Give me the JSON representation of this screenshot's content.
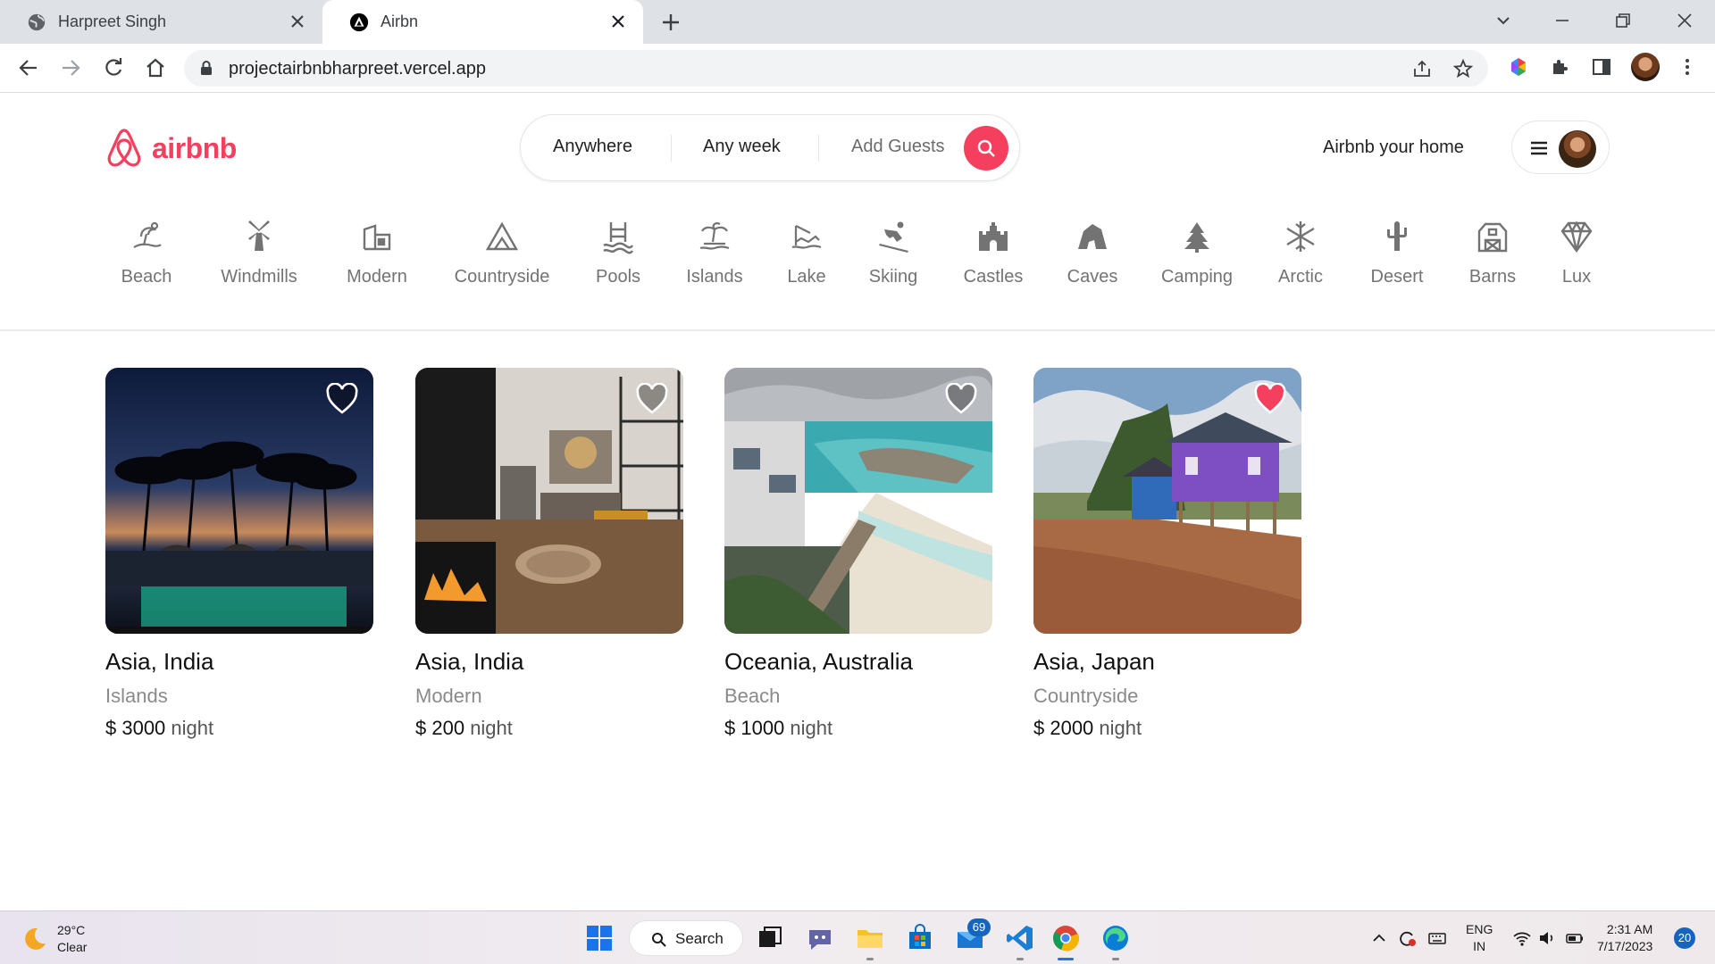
{
  "browser": {
    "tabs": [
      {
        "title": "Harpreet Singh",
        "active": false
      },
      {
        "title": "Airbn",
        "active": true
      }
    ],
    "url": "projectairbnbharpreet.vercel.app"
  },
  "header": {
    "brand": "airbnb",
    "brand_color": "#F43F5E",
    "search": {
      "where": "Anywhere",
      "when": "Any week",
      "who": "Add Guests"
    },
    "host_link": "Airbnb your home"
  },
  "categories": [
    {
      "label": "Beach",
      "icon": "beach-icon"
    },
    {
      "label": "Windmills",
      "icon": "windmill-icon"
    },
    {
      "label": "Modern",
      "icon": "modern-icon"
    },
    {
      "label": "Countryside",
      "icon": "mountain-icon"
    },
    {
      "label": "Pools",
      "icon": "pool-icon"
    },
    {
      "label": "Islands",
      "icon": "island-icon"
    },
    {
      "label": "Lake",
      "icon": "lake-icon"
    },
    {
      "label": "Skiing",
      "icon": "ski-icon"
    },
    {
      "label": "Castles",
      "icon": "castle-icon"
    },
    {
      "label": "Caves",
      "icon": "cave-icon"
    },
    {
      "label": "Camping",
      "icon": "tree-icon"
    },
    {
      "label": "Arctic",
      "icon": "snowflake-icon"
    },
    {
      "label": "Desert",
      "icon": "cactus-icon"
    },
    {
      "label": "Barns",
      "icon": "barn-icon"
    },
    {
      "label": "Lux",
      "icon": "diamond-icon"
    }
  ],
  "listings": [
    {
      "location": "Asia, India",
      "category": "Islands",
      "price": "$ 3000",
      "unit": "night",
      "favorited": false
    },
    {
      "location": "Asia, India",
      "category": "Modern",
      "price": "$ 200",
      "unit": "night",
      "favorited": false
    },
    {
      "location": "Oceania, Australia",
      "category": "Beach",
      "price": "$ 1000",
      "unit": "night",
      "favorited": false
    },
    {
      "location": "Asia, Japan",
      "category": "Countryside",
      "price": "$ 2000",
      "unit": "night",
      "favorited": true
    }
  ],
  "taskbar": {
    "weather": {
      "temp": "29°C",
      "condition": "Clear"
    },
    "search_label": "Search",
    "mail_badge": "69",
    "lang": {
      "line1": "ENG",
      "line2": "IN"
    },
    "clock": {
      "time": "2:31 AM",
      "date": "7/17/2023"
    },
    "notifications": "20"
  }
}
